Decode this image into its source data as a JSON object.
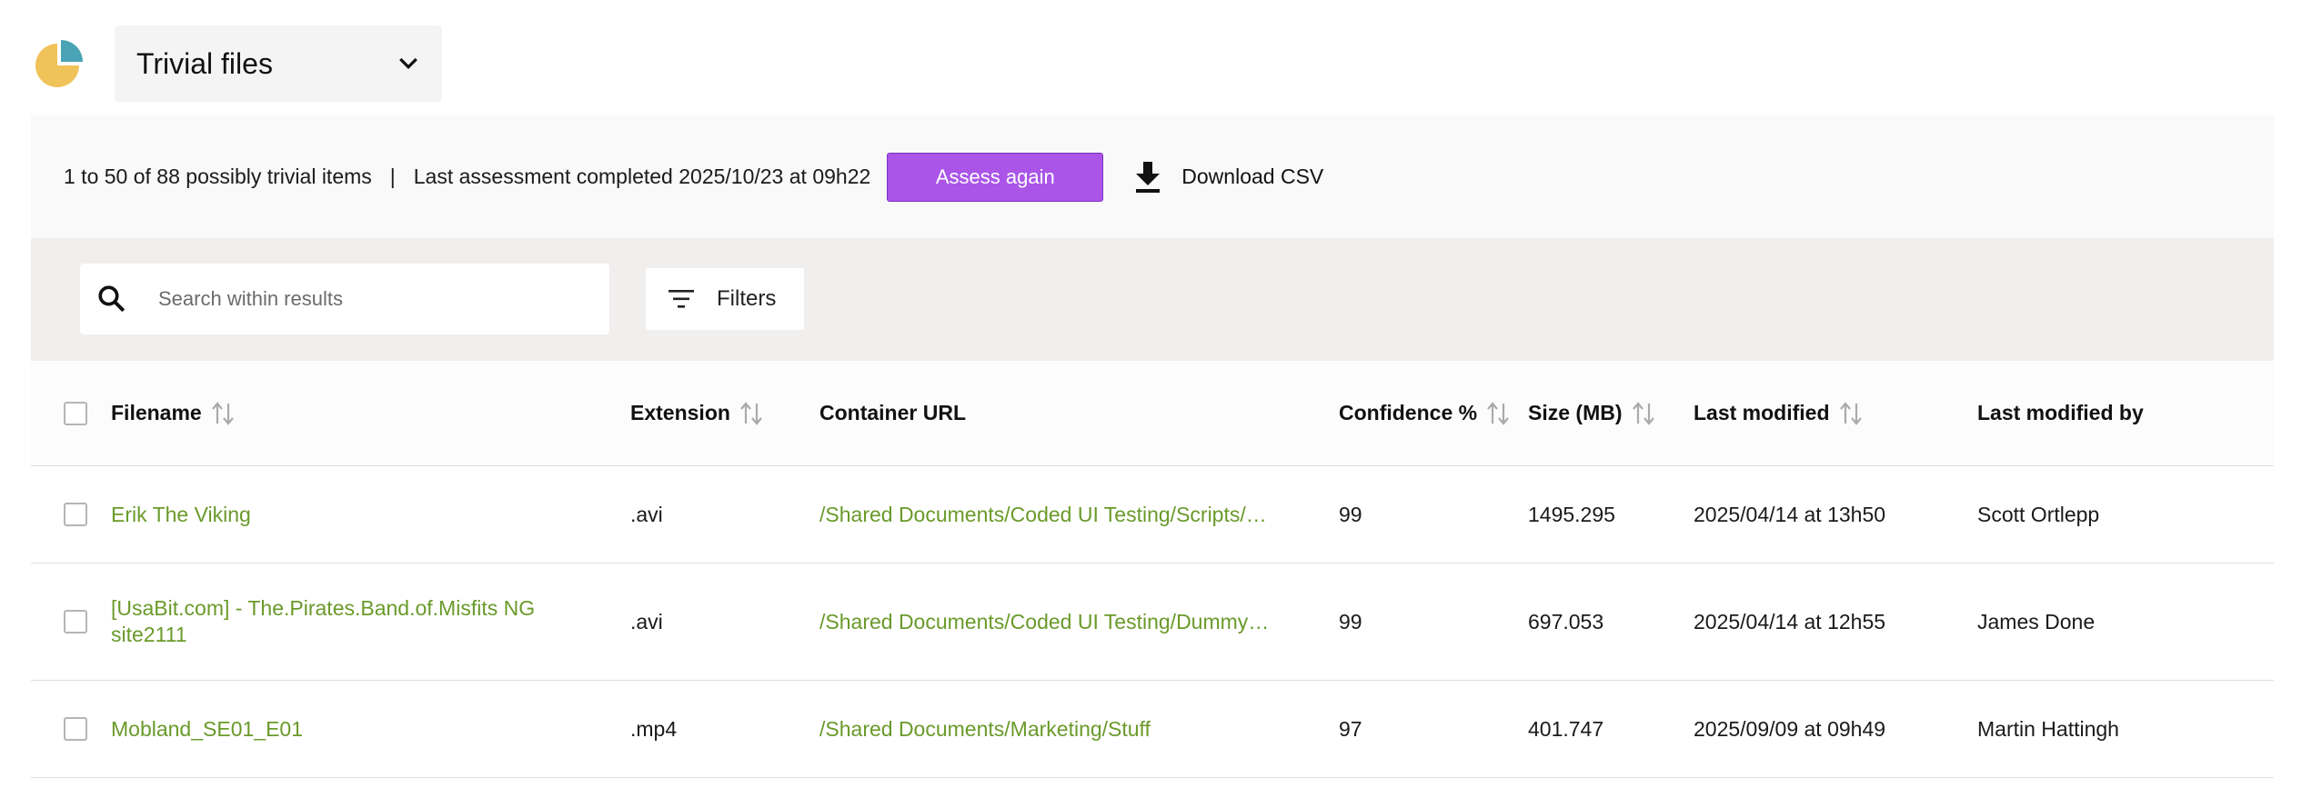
{
  "view_selector": {
    "label": "Trivial files"
  },
  "summary": {
    "count_text": "1 to 50 of 88 possibly trivial items",
    "separator": "|",
    "assessment_text": "Last assessment completed 2025/10/23 at 09h22",
    "assess_button": "Assess again",
    "download_label": "Download CSV"
  },
  "search": {
    "placeholder": "Search within results",
    "value": ""
  },
  "filters": {
    "label": "Filters"
  },
  "table": {
    "headers": {
      "filename": "Filename",
      "extension": "Extension",
      "container_url": "Container URL",
      "confidence": "Confidence %",
      "size": "Size (MB)",
      "last_modified": "Last modified",
      "last_modified_by": "Last modified by"
    },
    "rows": [
      {
        "filename": "Erik The Viking",
        "extension": ".avi",
        "container_url": "/Shared Documents/Coded UI Testing/Scripts/…",
        "confidence": "99",
        "size": "1495.295",
        "last_modified": "2025/04/14 at 13h50",
        "last_modified_by": "Scott Ortlepp"
      },
      {
        "filename": "[UsaBit.com] - The.Pirates.Band.of.Misfits NG site2111",
        "extension": ".avi",
        "container_url": "/Shared Documents/Coded UI Testing/Dummy …",
        "confidence": "99",
        "size": "697.053",
        "last_modified": "2025/04/14 at 12h55",
        "last_modified_by": "James Done"
      },
      {
        "filename": "Mobland_SE01_E01",
        "extension": ".mp4",
        "container_url": "/Shared Documents/Marketing/Stuff",
        "confidence": "97",
        "size": "401.747",
        "last_modified": "2025/09/09 at 09h49",
        "last_modified_by": "Martin Hattingh"
      }
    ]
  },
  "colors": {
    "accent_button": "#aa55e8",
    "link": "#6a9a2a",
    "logo_yellow": "#f0c35a",
    "logo_teal": "#4aa3b5"
  },
  "icons": [
    "pie-chart-logo-icon",
    "chevron-down-icon",
    "download-icon",
    "search-icon",
    "filter-icon",
    "sort-icon"
  ]
}
